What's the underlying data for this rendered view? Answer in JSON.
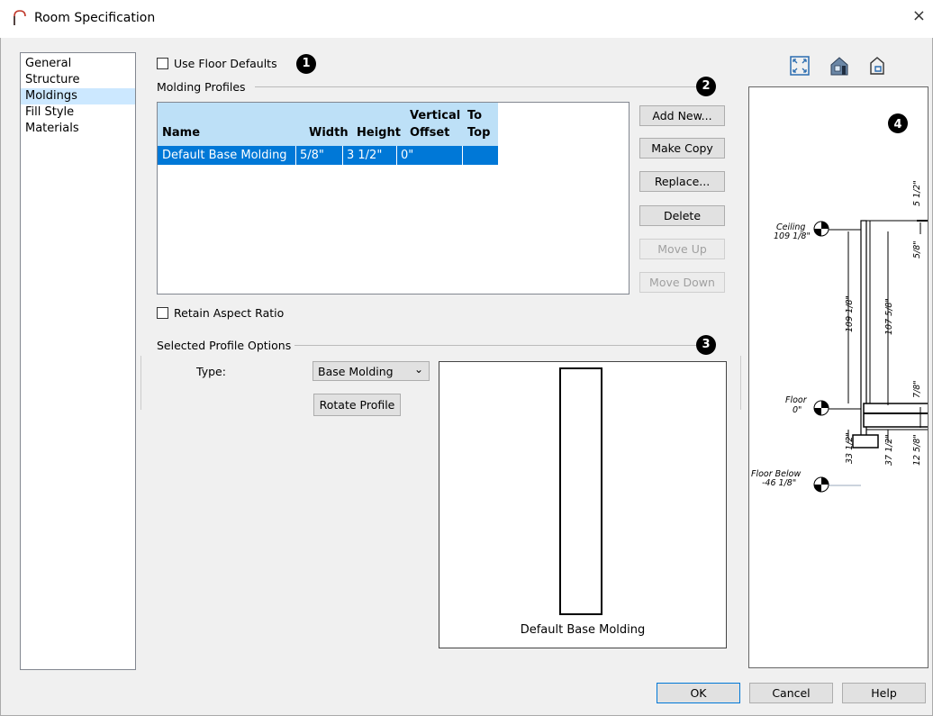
{
  "title": "Room Specification",
  "close_symbol": "×",
  "sidebar": {
    "items": [
      {
        "label": "General"
      },
      {
        "label": "Structure"
      },
      {
        "label": "Moldings"
      },
      {
        "label": "Fill Style"
      },
      {
        "label": "Materials"
      }
    ],
    "selected": "Moldings"
  },
  "use_floor_defaults": {
    "label": "Use Floor Defaults",
    "checked": false
  },
  "callouts": [
    "1",
    "2",
    "3",
    "4"
  ],
  "molding_profiles": {
    "label": "Molding Profiles",
    "columns": {
      "name": "Name",
      "width": "Width",
      "height": "Height",
      "voffset_1": "Vertical",
      "voffset_2": "Offset",
      "totop_1": "To",
      "totop_2": "Top"
    },
    "rows": [
      {
        "name": "Default Base Molding",
        "width": "5/8\"",
        "height": "3 1/2\"",
        "voffset": "0\"",
        "totop": ""
      }
    ]
  },
  "buttons": {
    "add_new": "Add New...",
    "make_copy": "Make Copy",
    "replace": "Replace...",
    "delete": "Delete",
    "move_up": "Move Up",
    "move_down": "Move Down",
    "rotate_profile": "Rotate Profile",
    "ok": "OK",
    "cancel": "Cancel",
    "help": "Help"
  },
  "retain_aspect_ratio": {
    "label": "Retain Aspect Ratio",
    "checked": false
  },
  "selected_profile_options": {
    "label": "Selected Profile Options",
    "type_label": "Type:",
    "type_value": "Base Molding",
    "preview_label": "Default Base Molding"
  },
  "section_view": {
    "labels": {
      "ceiling": "Ceiling",
      "ceiling_val": "109 1/8\"",
      "floor": "Floor",
      "floor_val": "0\"",
      "floor_below": "Floor Below",
      "floor_below_val": "-46 1/8\""
    },
    "dims": {
      "top": "5 1/2\"",
      "five_eighths": "5/8\"",
      "d109": "109 1/8\"",
      "d107": "107 5/8\"",
      "seven_eighths": "7/8\"",
      "d33": "33 1/2\"",
      "d37": "37 1/2\"",
      "d12": "12 5/8\""
    }
  },
  "toolbar_icons": [
    "fill-window-icon",
    "house-icon",
    "elevation-icon"
  ]
}
